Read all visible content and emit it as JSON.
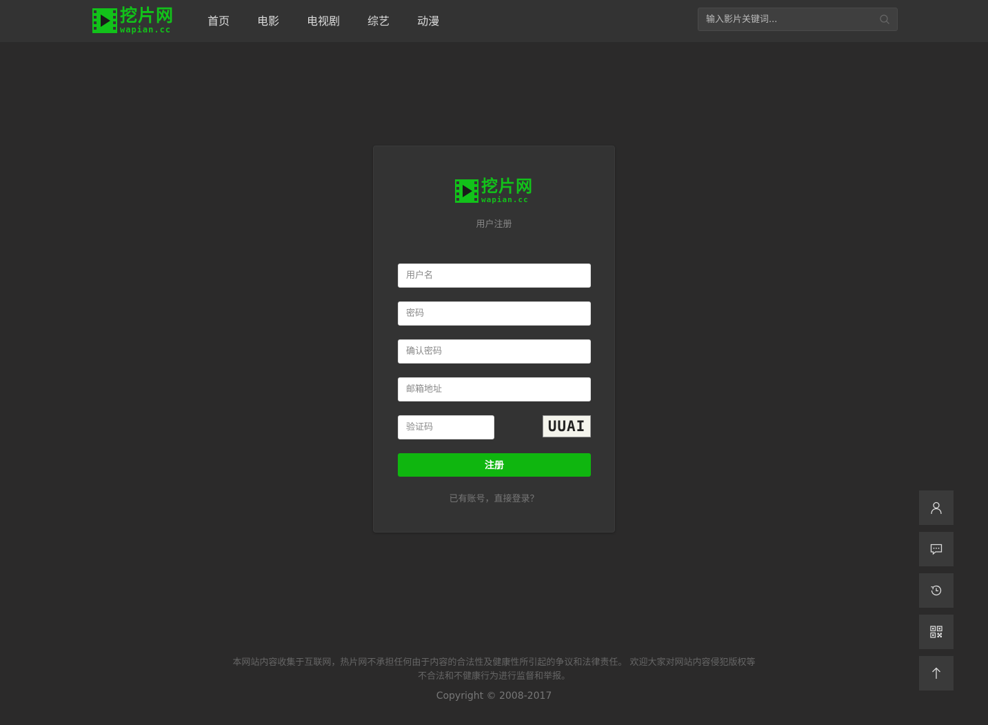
{
  "header": {
    "logo_cn": "挖片网",
    "logo_en": "wapian.cc",
    "nav": [
      "首页",
      "电影",
      "电视剧",
      "综艺",
      "动漫"
    ],
    "search_placeholder": "输入影片关键词..."
  },
  "card": {
    "logo_cn": "挖片网",
    "logo_en": "wapian.cc",
    "subtitle": "用户注册",
    "username_placeholder": "用户名",
    "password_placeholder": "密码",
    "confirm_placeholder": "确认密码",
    "email_placeholder": "邮箱地址",
    "code_placeholder": "验证码",
    "captcha_text": "UUAI",
    "submit_label": "注册",
    "login_link": "已有账号，直接登录？"
  },
  "tools": [
    "user-icon",
    "message-icon",
    "history-icon",
    "qrcode-icon",
    "arrow-up-icon"
  ],
  "footer": {
    "disclaimer": "本网站内容收集于互联网，热片网不承担任何由于内容的合法性及健康性所引起的争议和法律责任。 欢迎大家对网站内容侵犯版权等不合法和不健康行为进行监督和举报。",
    "copyright": "Copyright © 2008-2017"
  },
  "colors": {
    "accent": "#12c21a",
    "background": "#2b2a2a",
    "header": "#333333"
  }
}
